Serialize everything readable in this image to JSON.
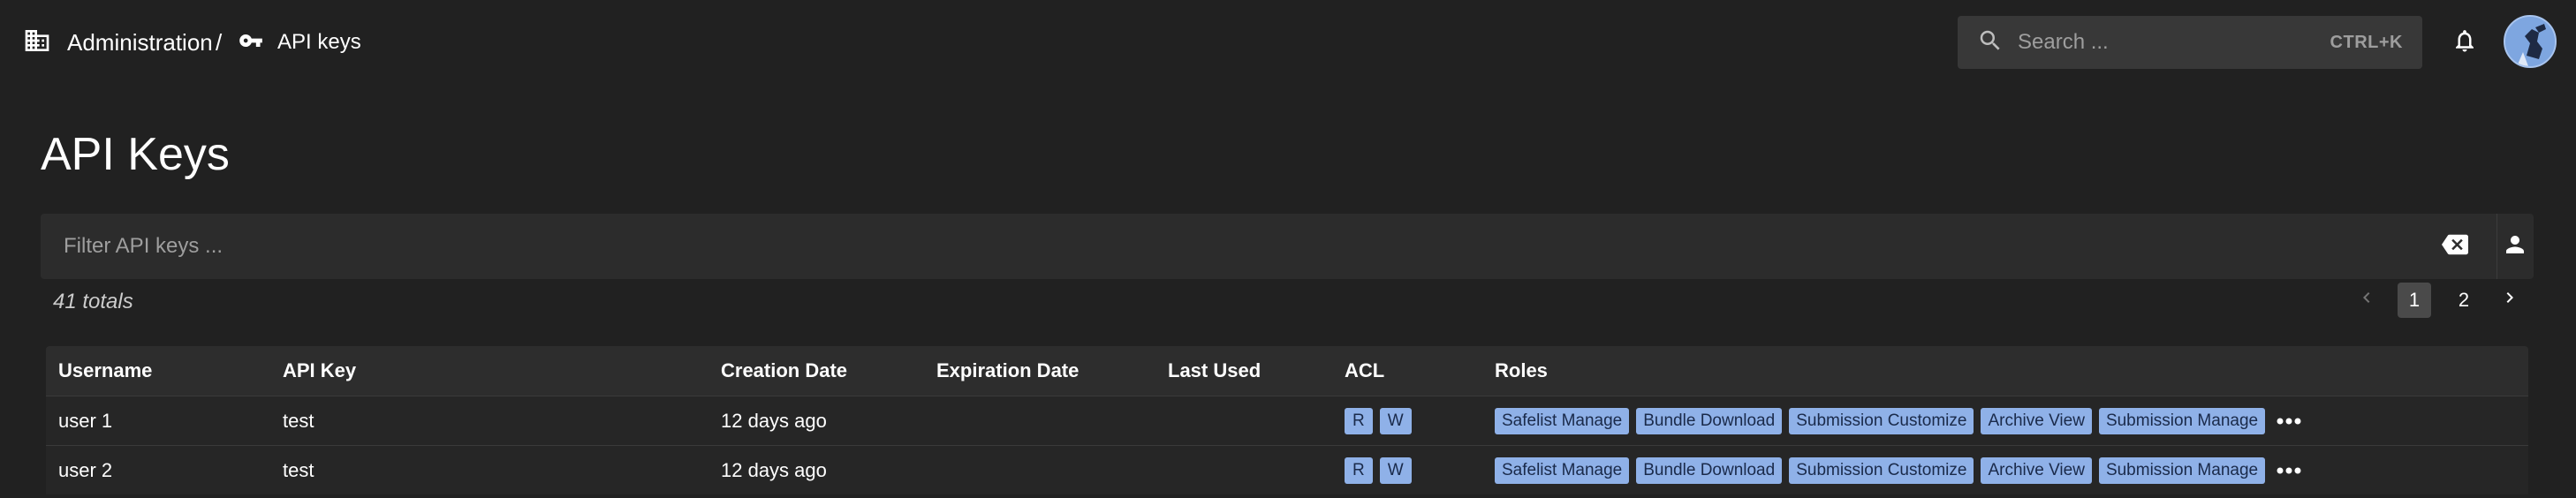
{
  "breadcrumb": {
    "admin_label": "Administration",
    "separator": "/",
    "current_label": "API keys"
  },
  "search": {
    "placeholder": "Search ...",
    "shortcut": "CTRL+K"
  },
  "page": {
    "title": "API Keys"
  },
  "filter": {
    "placeholder": "Filter API keys ..."
  },
  "totals": "41 totals",
  "pagination": {
    "pages": [
      "1",
      "2"
    ],
    "current": "1"
  },
  "table": {
    "headers": {
      "username": "Username",
      "api_key": "API Key",
      "creation_date": "Creation Date",
      "expiration_date": "Expiration Date",
      "last_used": "Last Used",
      "acl": "ACL",
      "roles": "Roles"
    },
    "rows": [
      {
        "username": "user 1",
        "api_key": "test",
        "creation_date": "12 days ago",
        "expiration_date": "",
        "last_used": "",
        "acl": [
          "R",
          "W"
        ],
        "roles": [
          "Safelist Manage",
          "Bundle Download",
          "Submission Customize",
          "Archive View",
          "Submission Manage"
        ]
      },
      {
        "username": "user 2",
        "api_key": "test",
        "creation_date": "12 days ago",
        "expiration_date": "",
        "last_used": "",
        "acl": [
          "R",
          "W"
        ],
        "roles": [
          "Safelist Manage",
          "Bundle Download",
          "Submission Customize",
          "Archive View",
          "Submission Manage"
        ]
      }
    ]
  },
  "icons": {
    "admin": "business-icon",
    "api_key": "key-icon",
    "search": "search-icon",
    "notifications": "bell-icon",
    "clear": "backspace-clear-icon",
    "user_filter": "person-icon",
    "prev": "chevron-left-icon",
    "next": "chevron-right-icon",
    "more": "more-horizontal-icon"
  },
  "colors": {
    "background": "#212121",
    "surface": "#2c2c2c",
    "chip": "#8fb1e8"
  }
}
